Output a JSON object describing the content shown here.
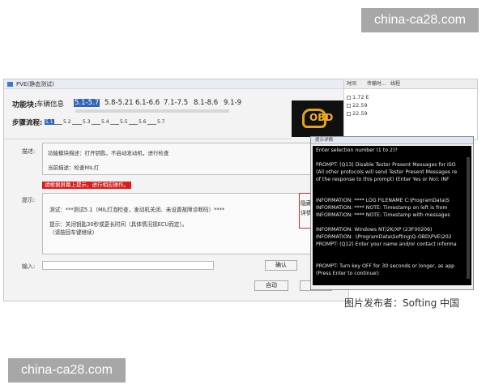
{
  "watermarks": {
    "top": "china-ca28.com",
    "bottom": "china-ca28.com"
  },
  "window": {
    "title": "PVE(静态测试)"
  },
  "function_bar": {
    "label": "功能块:",
    "tabs": [
      "车辆信息",
      "5.1-5.7",
      "5.8-5.21",
      "6.1-6.6",
      "7.1-7.5",
      "8.1-8.6",
      "9.1-9"
    ],
    "selected_tab": "5.1-5.7"
  },
  "steps": {
    "label": "步骤流程:",
    "nodes": [
      "5.1",
      "5.2",
      "5.3",
      "5.4",
      "5.5",
      "5.6",
      "5.7"
    ],
    "current": "5.1"
  },
  "logo": {
    "text": "OBD",
    "icon": "check-engine-icon"
  },
  "form": {
    "description_label": "描述:",
    "module_description": "功能模块描述：打开钥匙，不启动发动机，进行检查",
    "current_description": "当前描述：检查MIL灯",
    "alert": "请根据屏幕上提示，进行相应操作。",
    "prompt_label": "提示:",
    "prompt_lines": [
      "测试：***测试5.1（MIL灯泡检查，发动机关闭、未设置故障诊断码）****",
      "提示：关闭钥匙30秒或更长时间（具体情况视ECU而定）。",
      "（请按回车键继续）"
    ],
    "hide_details_button": "隐藏详情",
    "input_label": "输入:",
    "input_value": "",
    "confirm_button": "确认",
    "auto_button": "自动",
    "exit_button": "退出"
  },
  "grid": {
    "headers": [
      "时间",
      "传输时...",
      "线程"
    ],
    "rows": [
      "1.72 E",
      "22.59",
      "22.59"
    ]
  },
  "console": {
    "title": "提示详情",
    "lines": [
      "Enter selection number (1 to 2)?",
      "",
      "PROMPT: (Q13) Disable Tester Present Messages for ISO",
      "(All other protocols will send Tester Present Messages re",
      "of the response to this prompt)   (Enter Yes or No):  INF",
      "",
      "",
      "INFORMATION: **** LOG FILENAME C:\\ProgramData\\S",
      "INFORMATION: **** NOTE: Timestamp on left is from",
      "INFORMATION: **** NOTE: Timestamp with messages",
      "",
      "INFORMATION: Windows NT/2K/XP (23F00206)",
      "INFORMATION: :\\ProgramData\\Softing\\Q-OBD\\PVE\\202",
      "PROMPT: (Q12) Enter your name and/or contact informa",
      "",
      "",
      "PROMPT: Turn key OFF for 30 seconds or longer, as app",
      " (Press Enter to continue):"
    ]
  },
  "caption": "图片发布者：Softing 中国",
  "colors": {
    "accent": "#2f64b8",
    "alert": "#d91c1c",
    "console_bg": "#000000",
    "logo": "#f2b21c"
  }
}
